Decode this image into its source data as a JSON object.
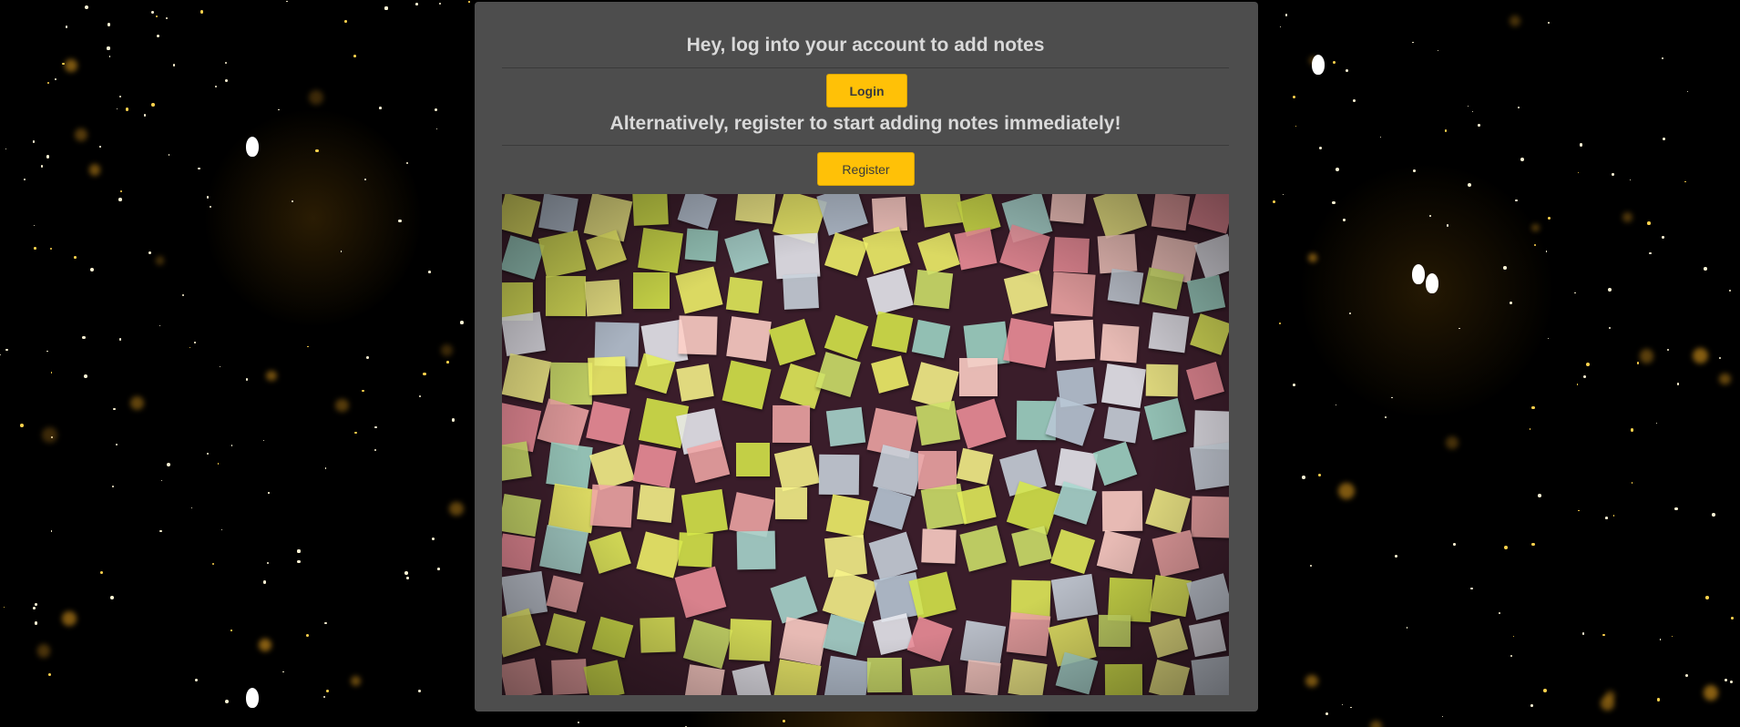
{
  "auth_panel": {
    "login_prompt": "Hey, log into your account to add notes",
    "login_label": "Login",
    "register_prompt": "Alternatively, register to start adding notes immediately!",
    "register_label": "Register"
  },
  "colors": {
    "panel_background": "#4d4d4d",
    "button_accent": "#ffc107",
    "heading_text": "#d9d9d9",
    "page_background": "#000000"
  },
  "hero_image": {
    "subject": "wall of colorful sticky notes"
  }
}
